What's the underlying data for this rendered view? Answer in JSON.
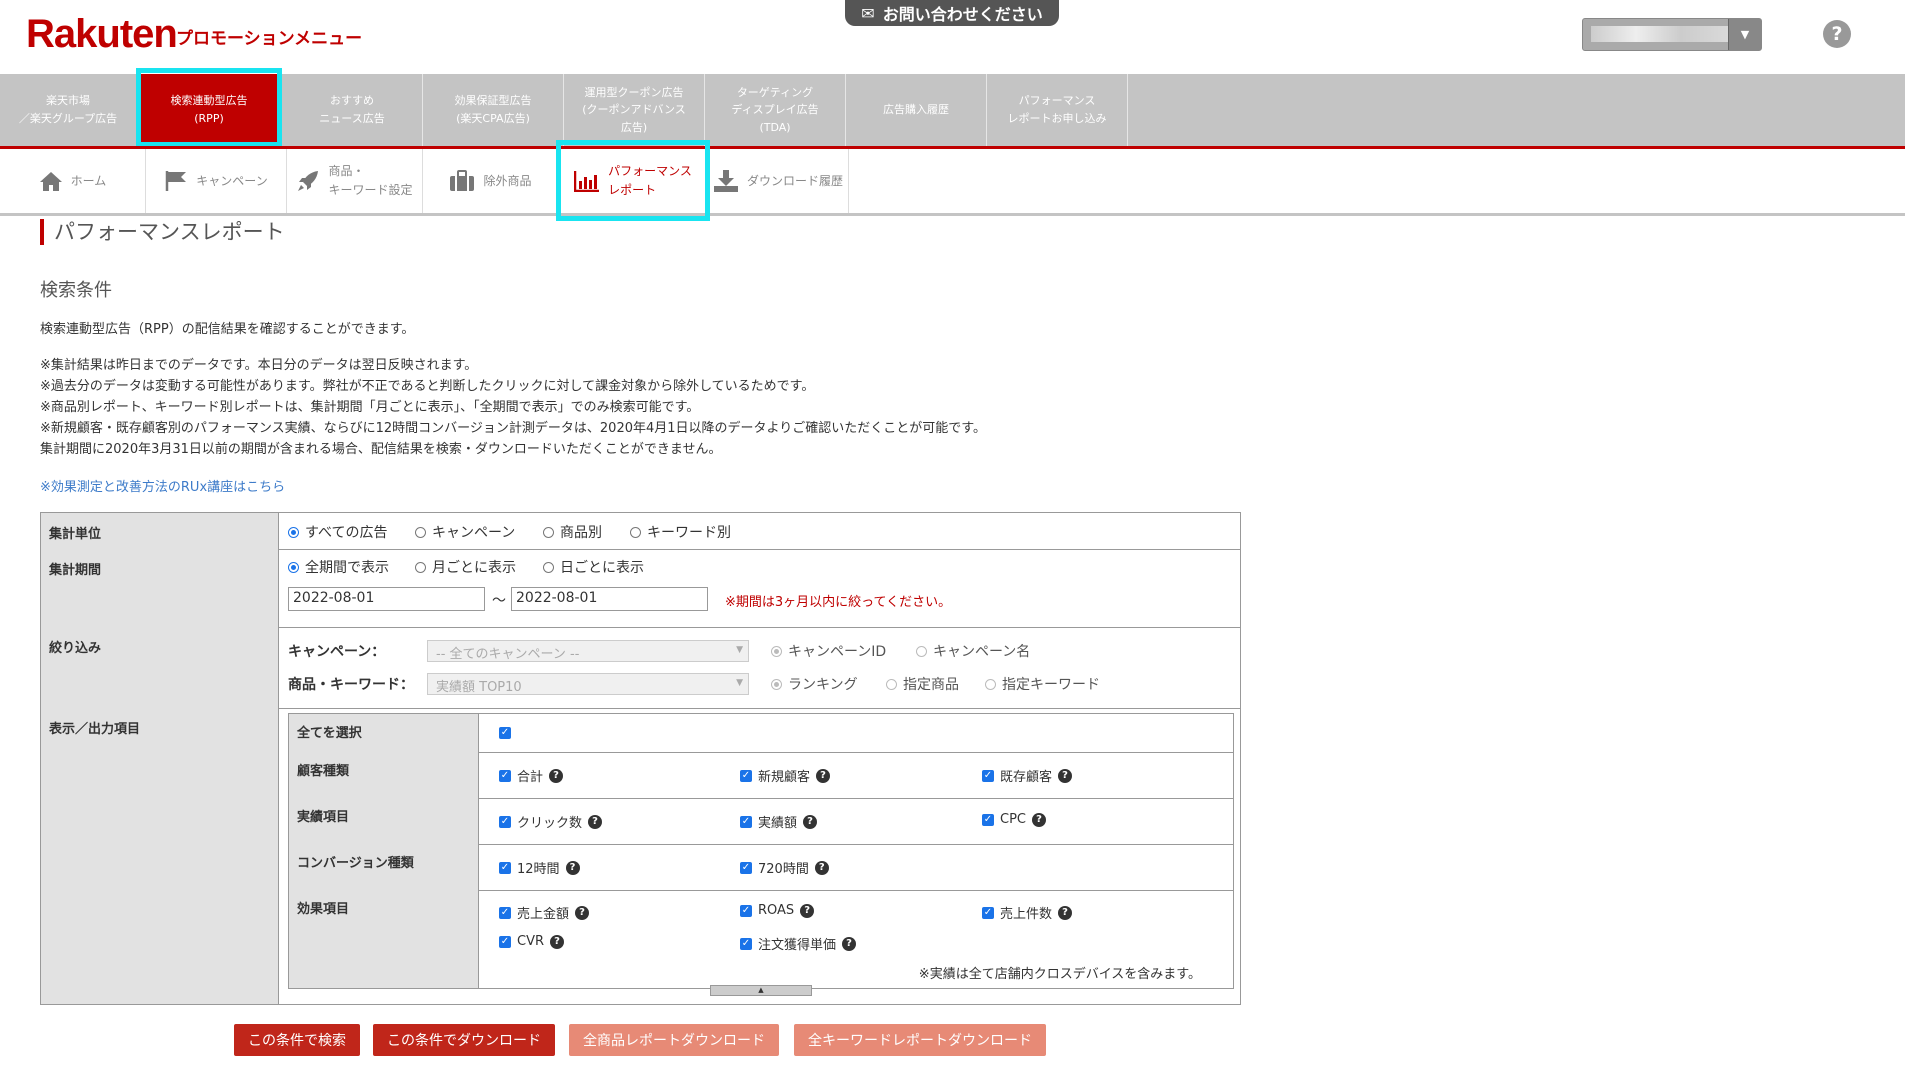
{
  "header": {
    "logo": "Rakuten",
    "logo_sub": "プロモーションメニュー",
    "contact": "お問い合わせください"
  },
  "top_nav": [
    {
      "label": "楽天市場\n／楽天グループ広告"
    },
    {
      "label": "検索連動型広告\n(RPP)"
    },
    {
      "label": "おすすめ\nニュース広告"
    },
    {
      "label": "効果保証型広告\n(楽天CPA広告)"
    },
    {
      "label": "運用型クーポン広告\n(クーポンアドバンス\n広告)"
    },
    {
      "label": "ターゲティング\nディスプレイ広告\n(TDA)"
    },
    {
      "label": "広告購入履歴"
    },
    {
      "label": "パフォーマンス\nレポートお申し込み"
    }
  ],
  "sub_nav": [
    {
      "label": "ホーム"
    },
    {
      "label": "キャンペーン"
    },
    {
      "label": "商品・\nキーワード設定"
    },
    {
      "label": "除外商品"
    },
    {
      "label": "パフォーマンス\nレポート"
    },
    {
      "label": "ダウンロード履歴"
    }
  ],
  "page_title": "パフォーマンスレポート",
  "section_title": "検索条件",
  "intro": "検索連動型広告（RPP）の配信結果を確認することができます。",
  "notes": [
    "※集計結果は昨日までのデータです。本日分のデータは翌日反映されます。",
    "※過去分のデータは変動する可能性があります。弊社が不正であると判断したクリックに対して課金対象から除外しているためです。",
    "※商品別レポート、キーワード別レポートは、集計期間「月ごとに表示」、「全期間で表示」でのみ検索可能です。",
    "※新規顧客・既存顧客別のパフォーマンス実績、ならびに12時間コンバージョン計測データは、2020年4月1日以降のデータよりご確認いただくことが可能です。",
    "集計期間に2020年3月31日以前の期間が含まれる場合、配信結果を検索・ダウンロードいただくことができません。"
  ],
  "rux_link": "※効果測定と改善方法のRUx講座はこちら",
  "form": {
    "unit": {
      "label": "集計単位",
      "options": [
        "すべての広告",
        "キャンペーン",
        "商品別",
        "キーワード別"
      ]
    },
    "period": {
      "label": "集計期間",
      "options": [
        "全期間で表示",
        "月ごとに表示",
        "日ごとに表示"
      ],
      "from": "2022-08-01",
      "tilde": "～",
      "to": "2022-08-01",
      "error": "※期間は3ヶ月以内に絞ってください。"
    },
    "filter": {
      "label": "絞り込み",
      "campaign_label": "キャンペーン：",
      "campaign_value": "-- 全てのキャンペーン --",
      "campaign_opts": [
        "キャンペーンID",
        "キャンペーン名"
      ],
      "item_label": "商品・キーワード：",
      "item_value": "実績額 TOP10",
      "item_opts": [
        "ランキング",
        "指定商品",
        "指定キーワード"
      ]
    },
    "output": {
      "label": "表示／出力項目",
      "select_all": "全てを選択",
      "customer": {
        "label": "顧客種類",
        "items": [
          "合計",
          "新規顧客",
          "既存顧客"
        ]
      },
      "results": {
        "label": "実績項目",
        "items": [
          "クリック数",
          "実績額",
          "CPC"
        ]
      },
      "conversion": {
        "label": "コンバージョン種類",
        "items": [
          "12時間",
          "720時間"
        ]
      },
      "effect": {
        "label": "効果項目",
        "items": [
          "売上金額",
          "ROAS",
          "売上件数",
          "CVR",
          "注文獲得単価"
        ]
      },
      "note": "※実績は全て店舗内クロスデバイスを含みます。"
    }
  },
  "buttons": [
    "この条件で検索",
    "この条件でダウンロード",
    "全商品レポートダウンロード",
    "全キーワードレポートダウンロード"
  ]
}
